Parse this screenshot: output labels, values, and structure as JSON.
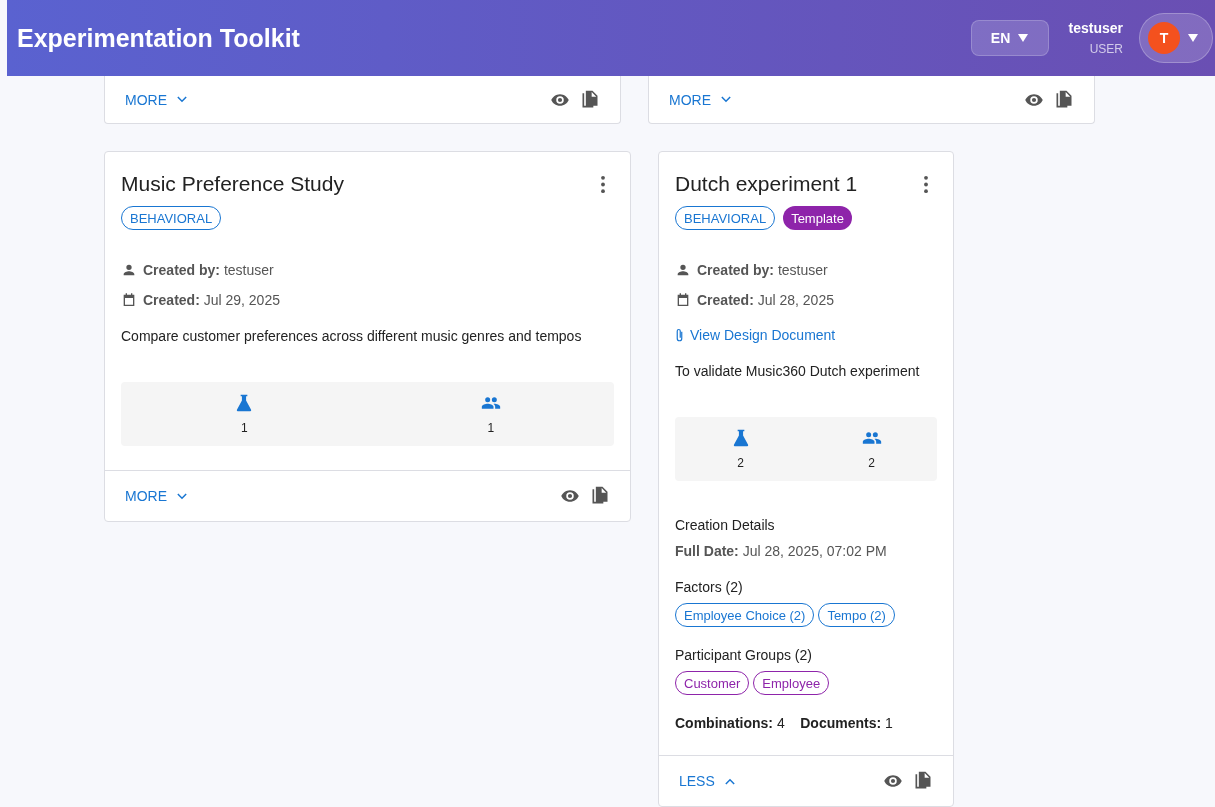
{
  "header": {
    "title": "Experimentation Toolkit",
    "language": "EN",
    "user": {
      "name": "testuser",
      "role": "USER",
      "initial": "T"
    }
  },
  "partial_cards": [
    {
      "expand_label": "MORE",
      "expanded": false
    },
    {
      "expand_label": "MORE",
      "expanded": false
    }
  ],
  "cards": [
    {
      "title": "Music Preference Study",
      "tags": [
        {
          "label": "BEHAVIORAL",
          "kind": "outline"
        }
      ],
      "created_by": "**Created by:** testuser",
      "created": "**Created:** Jul 29, 2025",
      "description": "Compare customer preferences across different music genres and tempos",
      "stats": [
        {
          "kind": "experiments",
          "value": "1"
        },
        {
          "kind": "participants",
          "value": "1"
        }
      ],
      "expanded": false,
      "expand_label": "MORE"
    },
    {
      "title": "Dutch experiment 1",
      "tags": [
        {
          "label": "BEHAVIORAL",
          "kind": "outline"
        },
        {
          "label": "Template",
          "kind": "filled"
        }
      ],
      "created_by": "**Created by:** testuser",
      "created": "**Created:** Jul 28, 2025",
      "design_document": "View Design Document",
      "description": "To validate Music360 Dutch experiment",
      "stats": [
        {
          "kind": "experiments",
          "value": "2"
        },
        {
          "kind": "participants",
          "value": "2"
        }
      ],
      "expanded": true,
      "expand_label": "LESS",
      "details": {
        "heading": "Creation Details",
        "full_date": "**Full Date:** Jul 28, 2025, 07:02 PM",
        "factors_heading": "Factors (2)",
        "factors": [
          "Employee Choice (2)",
          "Tempo (2)"
        ],
        "groups_heading": "Participant Groups (2)",
        "groups": [
          "Customer",
          "Employee"
        ],
        "summary": "**Combinations:** 4    **Documents:** 1"
      }
    }
  ]
}
